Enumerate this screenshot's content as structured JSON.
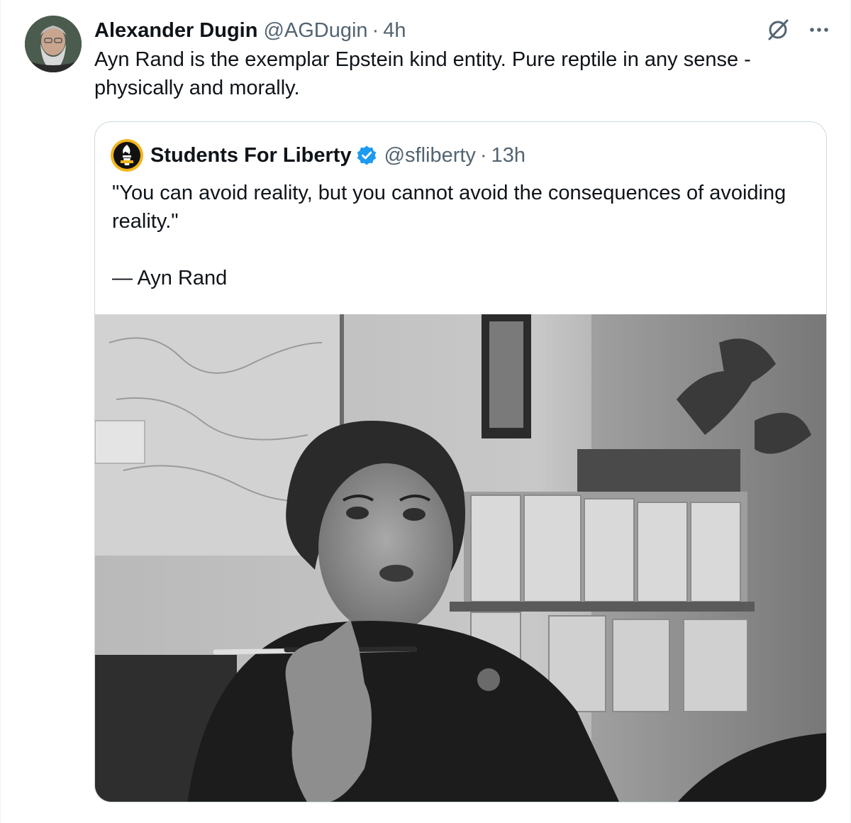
{
  "tweet": {
    "author_name": "Alexander Dugin",
    "author_handle": "@AGDugin",
    "separator": "·",
    "time": "4h",
    "text": "Ayn Rand is the exemplar Epstein kind entity. Pure reptile in any sense - physically and morally.",
    "avatar_icon": "bearded-man-avatar",
    "actions": [
      {
        "name": "grok-icon"
      },
      {
        "name": "more-options-icon"
      }
    ]
  },
  "quoted": {
    "author_name": "Students For Liberty",
    "author_handle": "@sfliberty",
    "separator": "·",
    "time": "13h",
    "verified": true,
    "verified_color": "#1d9bf0",
    "text": "\"You can avoid reality, but you cannot avoid the consequences of avoiding reality.\"\n\n— Ayn Rand",
    "avatar_icon": "torch-logo-avatar",
    "media": {
      "kind": "photo",
      "style": "black-and-white"
    }
  },
  "colors": {
    "text_primary": "#0f1419",
    "text_secondary": "#536471",
    "border": "#cfd9de",
    "verified": "#1d9bf0"
  }
}
